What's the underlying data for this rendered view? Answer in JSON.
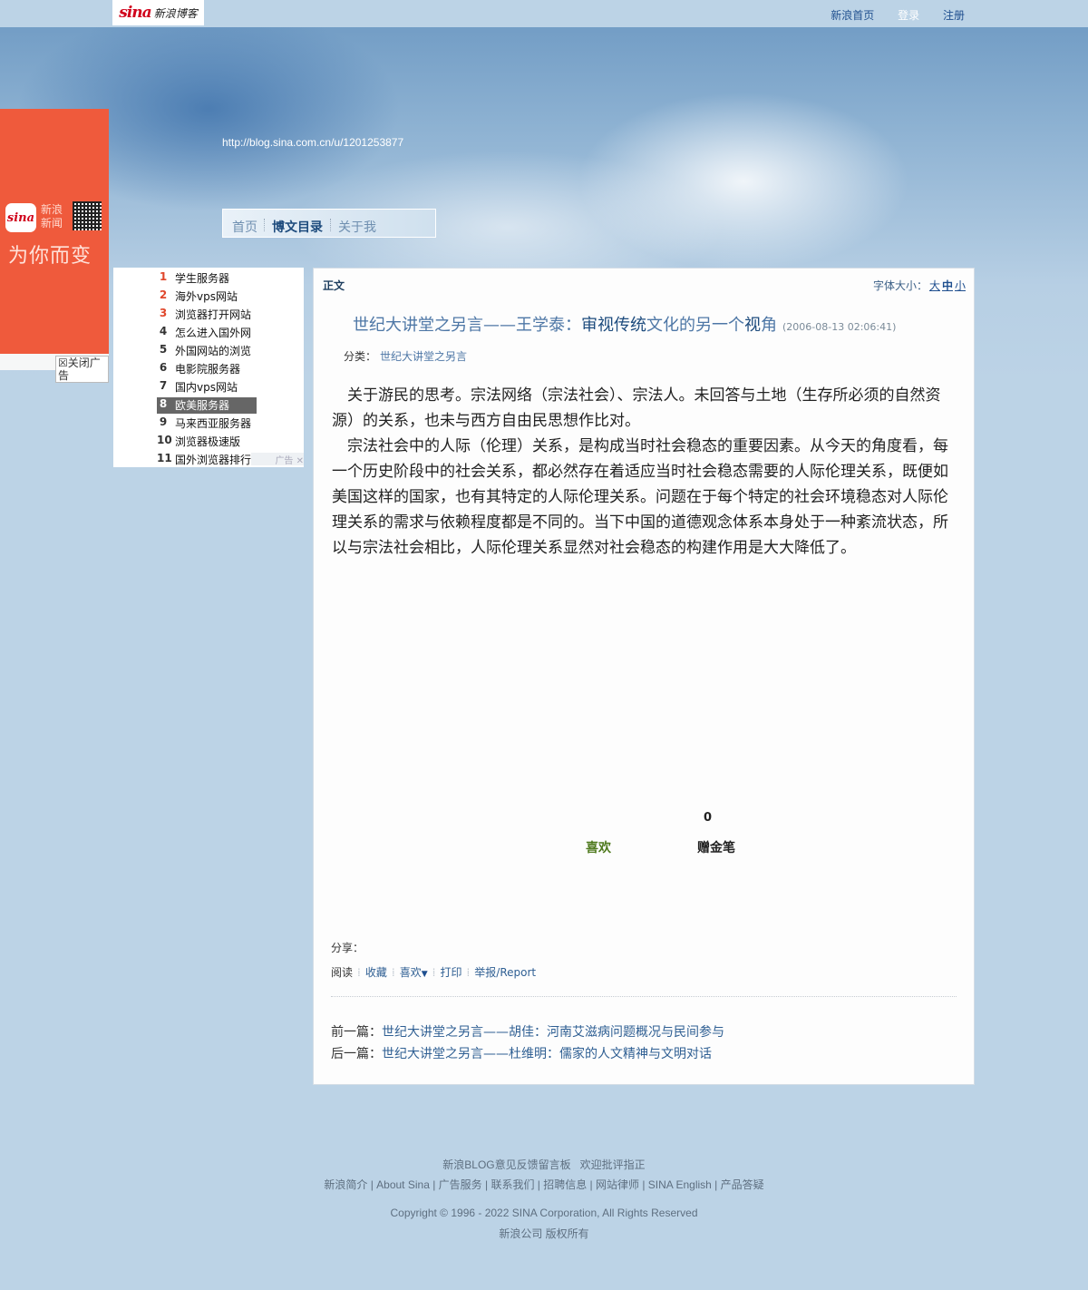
{
  "topbar": {
    "logo_sina": "sina",
    "logo_text": "新浪博客",
    "links": [
      "新浪首页",
      "登录",
      "注册"
    ]
  },
  "left_ad": {
    "brand": "sina",
    "news_label": "新浪新闻",
    "slogan": "为你而变",
    "close": "☒关闭广告"
  },
  "header": {
    "blog_url": "http://blog.sina.com.cn/u/1201253877"
  },
  "nav": {
    "items": [
      "首页",
      "博文目录",
      "关于我"
    ],
    "active_index": 1
  },
  "ranking": {
    "items": [
      {
        "num": "1",
        "text": "学生服务器"
      },
      {
        "num": "2",
        "text": "海外vps网站"
      },
      {
        "num": "3",
        "text": "浏览器打开网站"
      },
      {
        "num": "4",
        "text": "怎么进入国外网"
      },
      {
        "num": "5",
        "text": "外国网站的浏览"
      },
      {
        "num": "6",
        "text": "电影院服务器"
      },
      {
        "num": "7",
        "text": "国内vps网站"
      },
      {
        "num": "8",
        "text": "欧美服务器"
      },
      {
        "num": "9",
        "text": "马来西亚服务器"
      },
      {
        "num": "10",
        "text": "浏览器极速版"
      },
      {
        "num": "11",
        "text": "国外浏览器排行"
      }
    ],
    "highlighted_index": 7,
    "ad_tag": "广告"
  },
  "article": {
    "tag": "正文",
    "font_size_label": "字体大小：",
    "font_sizes": [
      "大",
      "中",
      "小"
    ],
    "title_part1": "世纪大讲堂之另言——王学泰：",
    "title_part2": "审视传统",
    "title_part3": "文化的另一个",
    "title_part4": "视",
    "title_part5": "角",
    "time": "(2006-08-13 02:06:41)",
    "category_label": "分类：",
    "category": "世纪大讲堂之另言",
    "paragraphs": [
      "关于游民的思考。宗法网络（宗法社会）、宗法人。未回答与土地（生存所必须的自然资源）的关系，也未与西方自由民思想作比对。",
      "宗法社会中的人际（伦理）关系，是构成当时社会稳态的重要因素。从今天的角度看，每一个历史阶段中的社会关系，都必然存在着适应当时社会稳态需要的人际伦理关系，既便如美国这样的国家，也有其特定的人际伦理关系。问题在于每个特定的社会环境稳态对人际伦理关系的需求与依赖程度都是不同的。当下中国的道德观念体系本身处于一种紊流状态，所以与宗法社会相比，人际伦理关系显然对社会稳态的构建作用是大大降低了。"
    ],
    "like_count": "0",
    "like_label": "喜欢",
    "gold_pen_label": "赠金笔",
    "share_label": "分享：",
    "actions": {
      "read": "阅读",
      "favorite": "收藏",
      "like": "喜欢",
      "like_arrow": "▼",
      "print": "打印",
      "report": "举报/Report"
    },
    "prev_label": "前一篇：",
    "prev_title": "世纪大讲堂之另言——胡佳：河南艾滋病问题概况与民间参与",
    "next_label": "后一篇：",
    "next_title": "世纪大讲堂之另言——杜维明：儒家的人文精神与文明对话"
  },
  "footer": {
    "feedback": "新浪BLOG意见反馈留言板",
    "welcome": "欢迎批评指正",
    "links": "新浪简介 | About Sina | 广告服务 | 联系我们 | 招聘信息 | 网站律师 | SINA English | 产品答疑",
    "copyright": "Copyright © 1996 - 2022 SINA Corporation, All Rights Reserved",
    "rights": "新浪公司 版权所有"
  }
}
